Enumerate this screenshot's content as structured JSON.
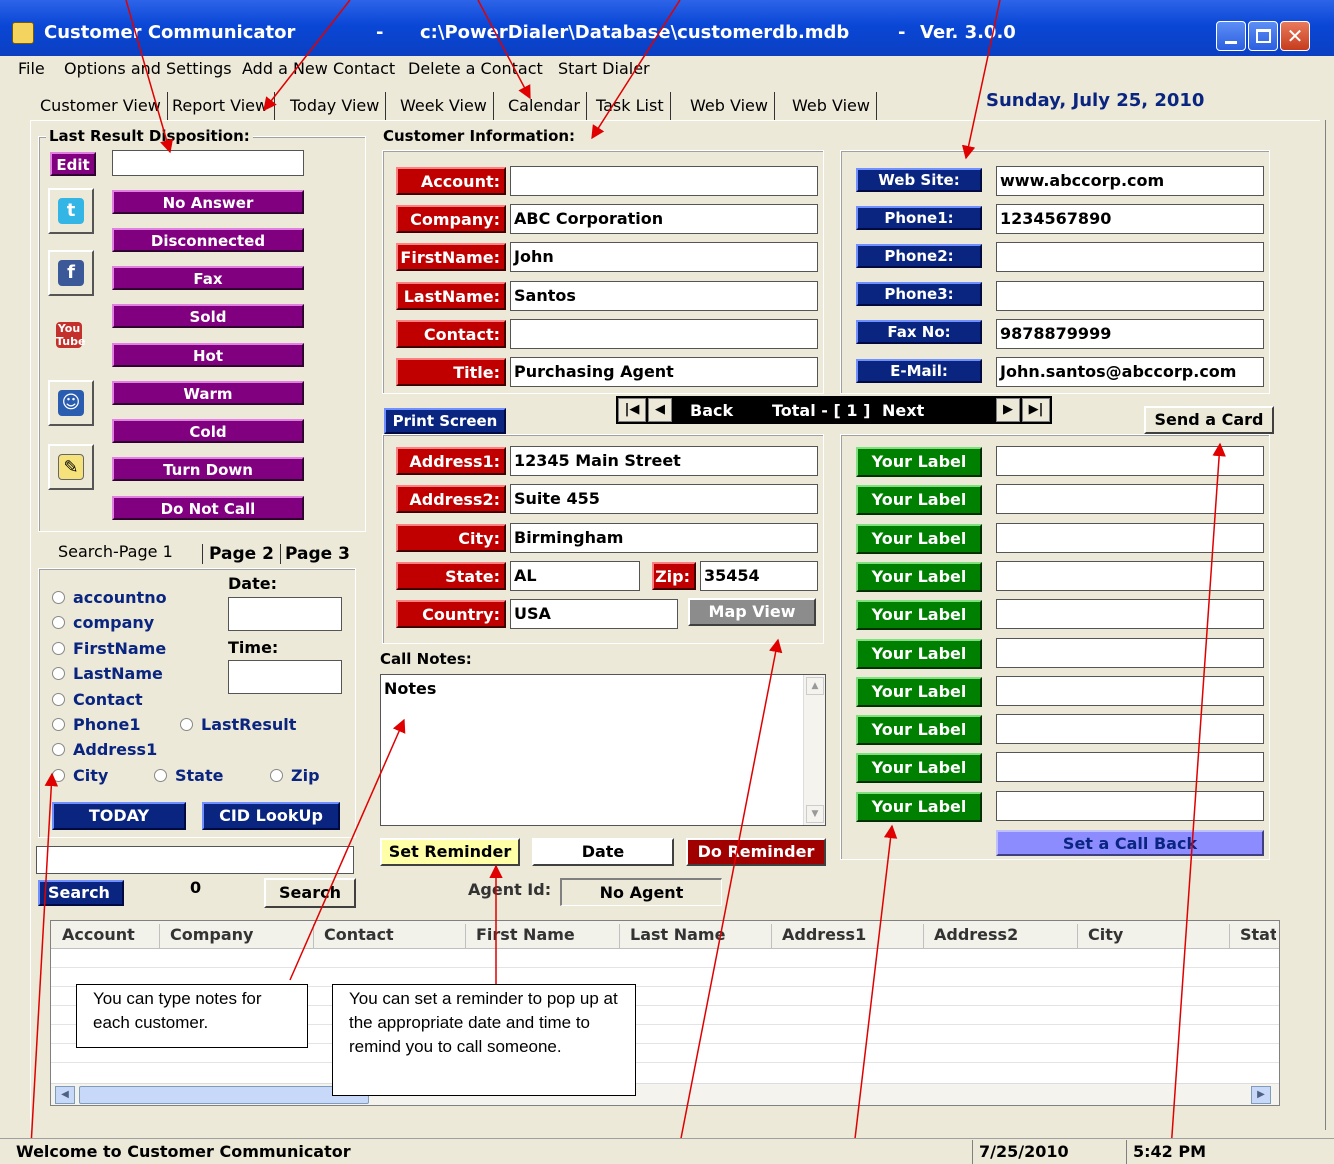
{
  "window": {
    "app_title": "Customer Communicator",
    "db_path": "c:\\PowerDialer\\Database\\customerdb.mdb",
    "dash": "-",
    "version": "Ver. 3.0.0"
  },
  "menu": [
    "File",
    "Options and Settings",
    "Add a New Contact",
    "Delete a Contact",
    "Start Dialer"
  ],
  "tabs": [
    "Customer View",
    "Report View",
    "Today View",
    "Week View",
    "Calendar",
    "Task List",
    "Web View",
    "Web View"
  ],
  "date_header": "Sunday, July 25, 2010",
  "disposition": {
    "title": "Last Result Disposition:",
    "edit": "Edit",
    "value": "",
    "buttons": [
      "No Answer",
      "Disconnected",
      "Fax",
      "Sold",
      "Hot",
      "Warm",
      "Cold",
      "Turn Down",
      "Do Not Call"
    ],
    "icons": [
      "twitter-icon",
      "facebook-icon",
      "youtube-icon",
      "messenger-icon",
      "notes-icon"
    ]
  },
  "customer": {
    "title": "Customer Information:",
    "labels": [
      "Account:",
      "Company:",
      "FirstName:",
      "LastName:",
      "Contact:",
      "Title:"
    ],
    "values": [
      "",
      "ABC Corporation",
      "John",
      "Santos",
      "",
      "Purchasing Agent"
    ]
  },
  "contact": {
    "labels": [
      "Web Site:",
      "Phone1:",
      "Phone2:",
      "Phone3:",
      "Fax No:",
      "E-Mail:"
    ],
    "values": [
      "www.abccorp.com",
      "1234567890",
      "",
      "",
      "9878879999",
      "John.santos@abccorp.com"
    ]
  },
  "nav": {
    "print_screen": "Print Screen",
    "back": "Back",
    "total": "Total - [ 1 ]",
    "next": "Next",
    "send_card": "Send a Card"
  },
  "address": {
    "labels": [
      "Address1:",
      "Address2:",
      "City:",
      "State:",
      "Zip:",
      "Country:"
    ],
    "values": [
      "12345 Main Street",
      "Suite 455",
      "Birmingham",
      "AL",
      "35454",
      "USA"
    ],
    "map_view": "Map View"
  },
  "custom": {
    "label": "Your Label",
    "count": 10,
    "set_callback": "Set a Call Back"
  },
  "notes": {
    "title": "Call Notes:",
    "text": "Notes",
    "set_reminder": "Set Reminder",
    "date": "Date",
    "do_reminder": "Do Reminder"
  },
  "search": {
    "tabs": [
      "Search-Page 1",
      "Page 2",
      "Page 3"
    ],
    "date_label": "Date:",
    "time_label": "Time:",
    "options": [
      "accountno",
      "company",
      "FirstName",
      "LastName",
      "Contact",
      "Phone1",
      "LastResult",
      "Address1",
      "City",
      "State",
      "Zip"
    ],
    "today": "TODAY",
    "cid": "CID LookUp",
    "search_label": "Search",
    "count": "0",
    "search_button": "Search",
    "agent_label": "Agent Id:",
    "agent_value": "No Agent"
  },
  "grid": {
    "columns": [
      "Account",
      "Company",
      "Contact",
      "First Name",
      "Last Name",
      "Address1",
      "Address2",
      "City",
      "Stat"
    ]
  },
  "callouts": {
    "notes_tip": "You can type notes for each customer.",
    "reminder_tip": "You can set a reminder to pop up at the appropriate date and time to remind you to call someone."
  },
  "status": {
    "welcome": "Welcome to Customer Communicator",
    "date": "7/25/2010",
    "time": "5:42 PM"
  },
  "colors": {
    "red": "#c00000",
    "purple": "#800080",
    "navy": "#0a2580",
    "green": "#008000"
  }
}
